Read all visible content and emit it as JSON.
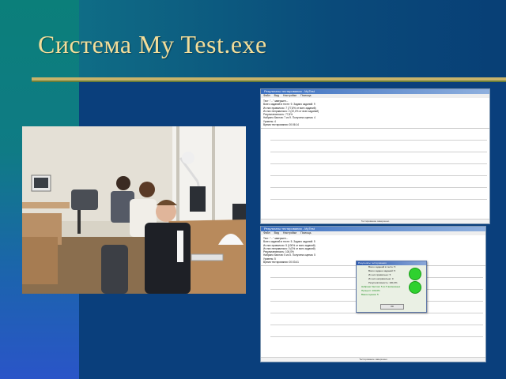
{
  "slide": {
    "title": "Система  My Test.exe",
    "colors": {
      "title_text": "#f2dd9a",
      "rule": "#c8b36a",
      "background": "#063a78",
      "result_dot": "#2fd12f"
    }
  },
  "screenshot_1": {
    "window_title": "Результаты тестирования - MyTest",
    "menu": [
      "Файл",
      "Вид",
      "Настройки",
      "Помощь"
    ],
    "report_lines": [
      "Тест: \"...\" завершен...",
      "Всего заданий в тесте: 9. Задано заданий: 9",
      "Из них правильно: 7 (77,8% от всех заданий)",
      "Из них неправильно: 2 (22,2% от всех заданий)",
      "Результативность: 77,8%",
      "Набрано баллов: 7 из 9. Получена оценка: 4",
      "Уровень: 4",
      "Время тестирования: 00:06:14"
    ],
    "status": "Тестирование завершено"
  },
  "screenshot_2": {
    "window_title": "Результаты тестирования - MyTest",
    "menu": [
      "Файл",
      "Вид",
      "Настройки",
      "Помощь"
    ],
    "report_lines": [
      "Тест: \"...\" завершен...",
      "Всего заданий в тесте: 5. Задано заданий: 5",
      "Из них правильно: 5 (100% от всех заданий)",
      "Из них неправильно: 0 (0% от всех заданий)",
      "Результативность: 100,0%",
      "Набрано баллов: 5 из 5. Получена оценка: 5",
      "Уровень: 5",
      "Время тестирования: 00:03:41"
    ],
    "dialog": {
      "title": "Результаты тестирования",
      "lines": [
        "Всего заданий в тесте:   5",
        "Всего задано заданий:   5",
        "Из них правильно:   5",
        "Из них неправильно:   0",
        "Результативность:   100,0%"
      ],
      "score_line": "Набрано баллов: 5 из 5 возможных",
      "percent_line": "Процент:   100,0%",
      "grade_line": "Ваша оценка: 5",
      "ok_label": "ОК"
    },
    "status": "Тестирование завершено"
  }
}
